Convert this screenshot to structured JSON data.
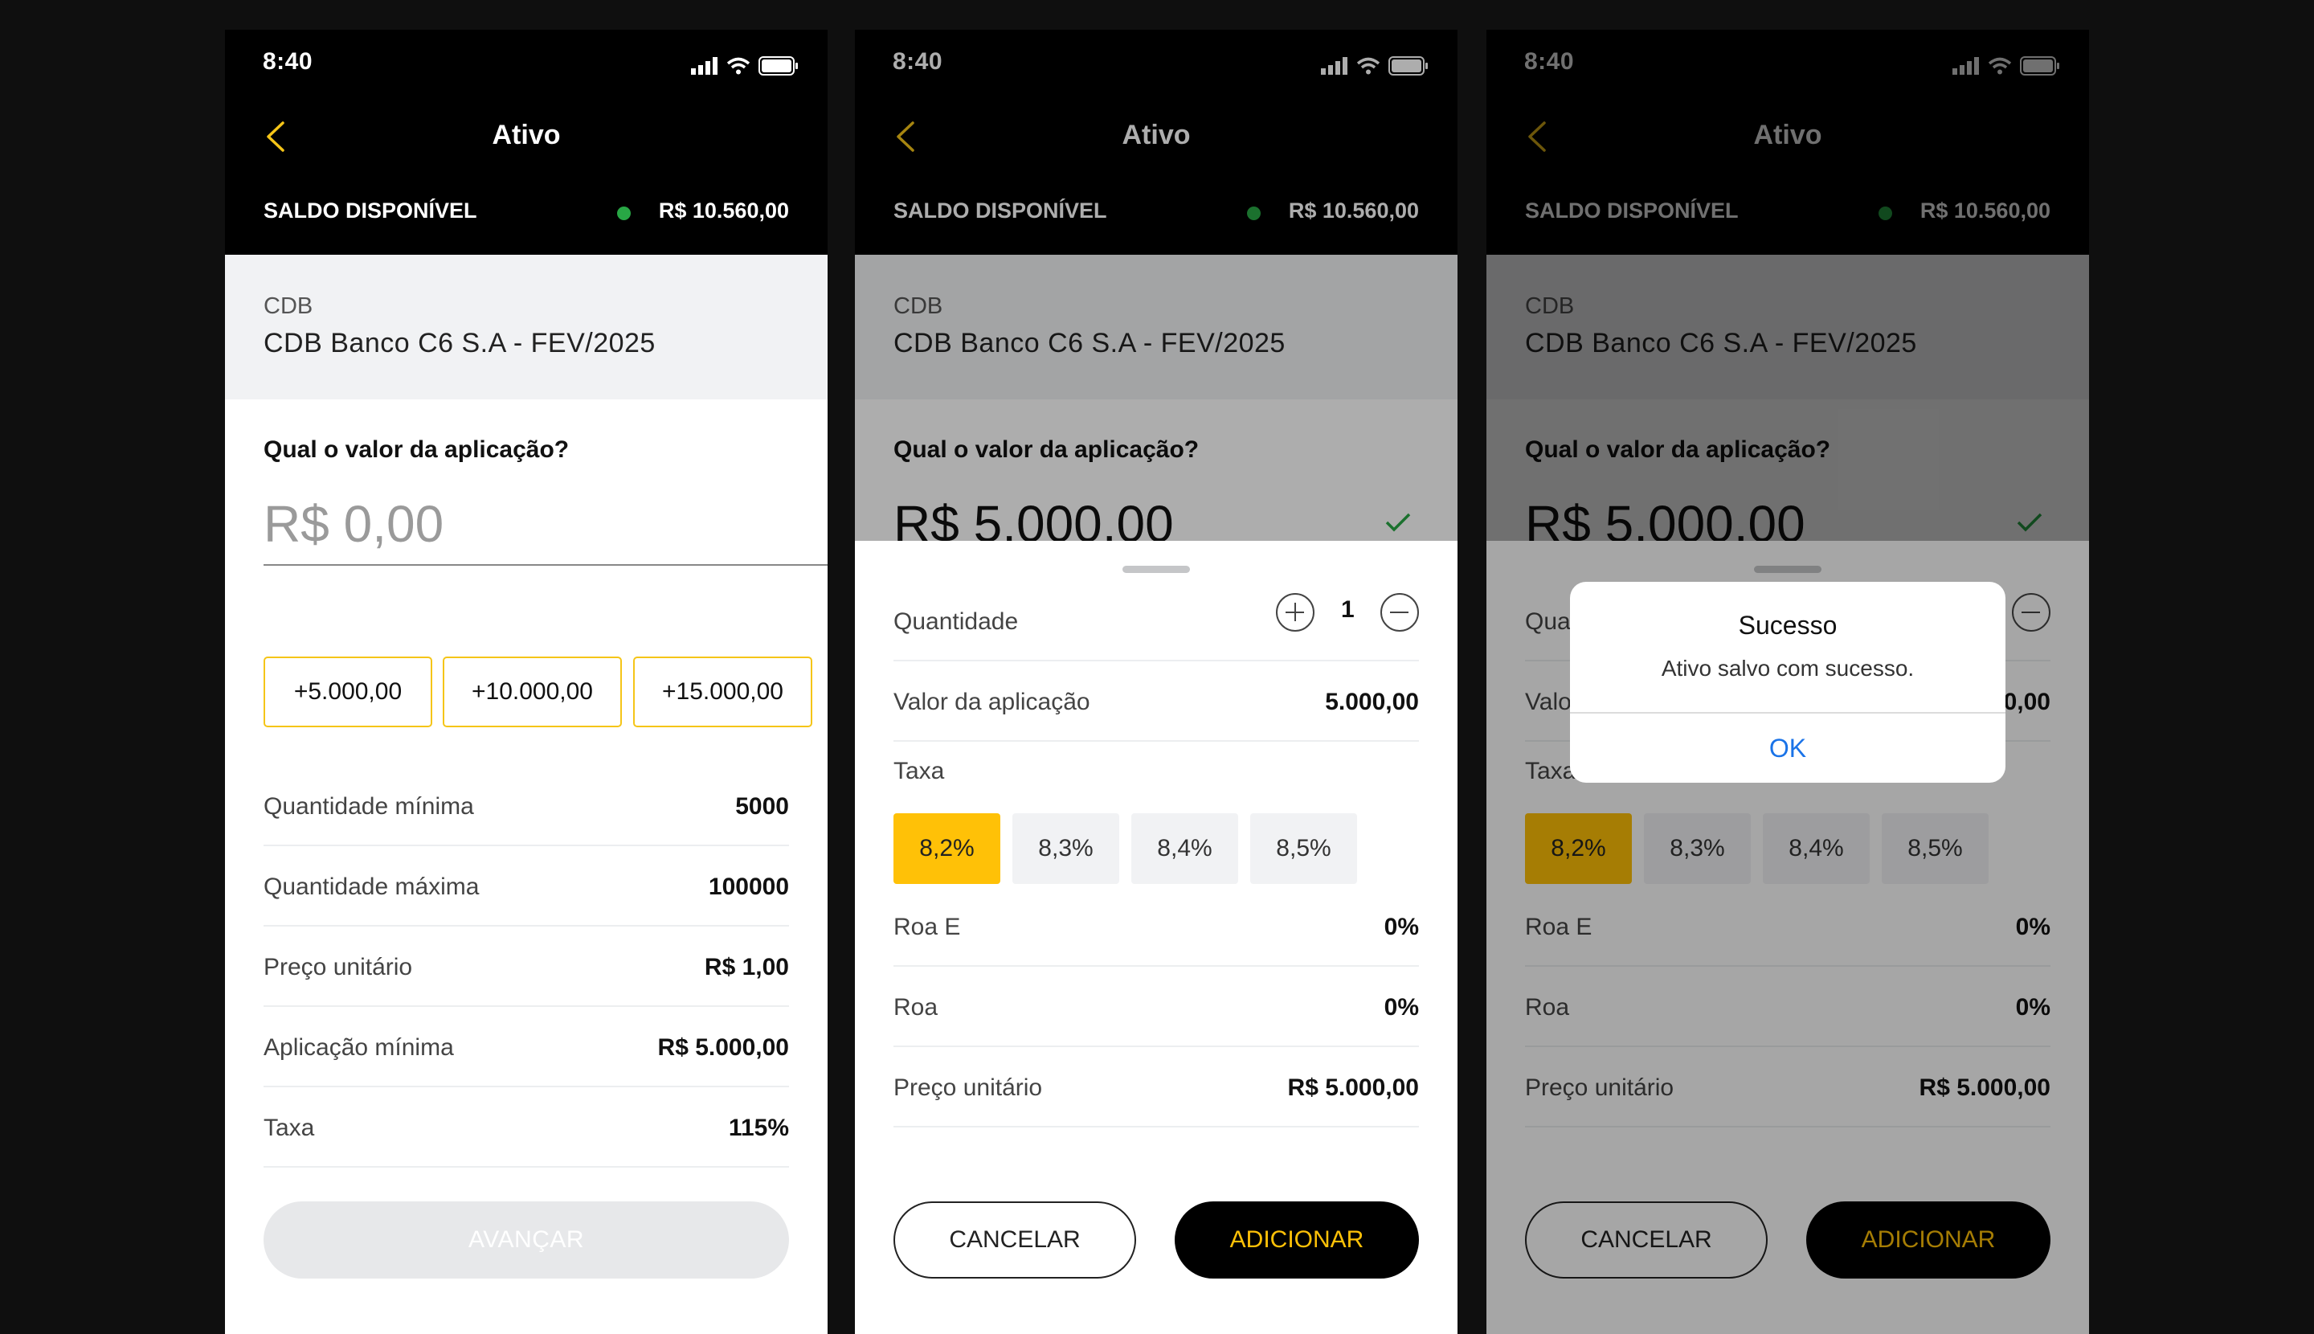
{
  "status": {
    "time": "8:40"
  },
  "nav": {
    "title": "Ativo"
  },
  "saldo": {
    "label": "SALDO DISPONÍVEL",
    "value": "R$ 10.560,00",
    "dot_color": "#28a745"
  },
  "asset": {
    "type": "CDB",
    "name": "CDB Banco C6 S.A - FEV/2025"
  },
  "form": {
    "question": "Qual o valor da aplicação?",
    "placeholder_amount": "R$ 0,00",
    "filled_amount": "R$ 5.000,00",
    "quick_values": [
      "+5.000,00",
      "+10.000,00",
      "+15.000,00"
    ],
    "details": [
      {
        "label": "Quantidade mínima",
        "value": "5000"
      },
      {
        "label": "Quantidade máxima",
        "value": "100000"
      },
      {
        "label": "Preço unitário",
        "value": "R$ 1,00"
      },
      {
        "label": "Aplicação mínima",
        "value": "R$ 5.000,00"
      },
      {
        "label": "Taxa",
        "value": "115%"
      }
    ],
    "advance_label": "AVANÇAR"
  },
  "sheet": {
    "quantity_label": "Quantidade",
    "quantity_value": "1",
    "application_label": "Valor da aplicação",
    "application_value": "5.000,00",
    "rate_label": "Taxa",
    "rates": [
      "8,2%",
      "8,3%",
      "8,4%",
      "8,5%"
    ],
    "selected_rate": "8,2%",
    "rows": [
      {
        "label": "Roa E",
        "value": "0%"
      },
      {
        "label": "Roa",
        "value": "0%"
      },
      {
        "label": "Preço unitário",
        "value": "R$ 5.000,00"
      }
    ],
    "cancel_label": "CANCELAR",
    "add_label": "ADICIONAR"
  },
  "alert": {
    "title": "Sucesso",
    "message": "Ativo salvo com sucesso.",
    "ok_label": "OK"
  },
  "colors": {
    "accent": "#ffc107",
    "ok_link": "#1a73e8",
    "success_check": "#28a745"
  }
}
